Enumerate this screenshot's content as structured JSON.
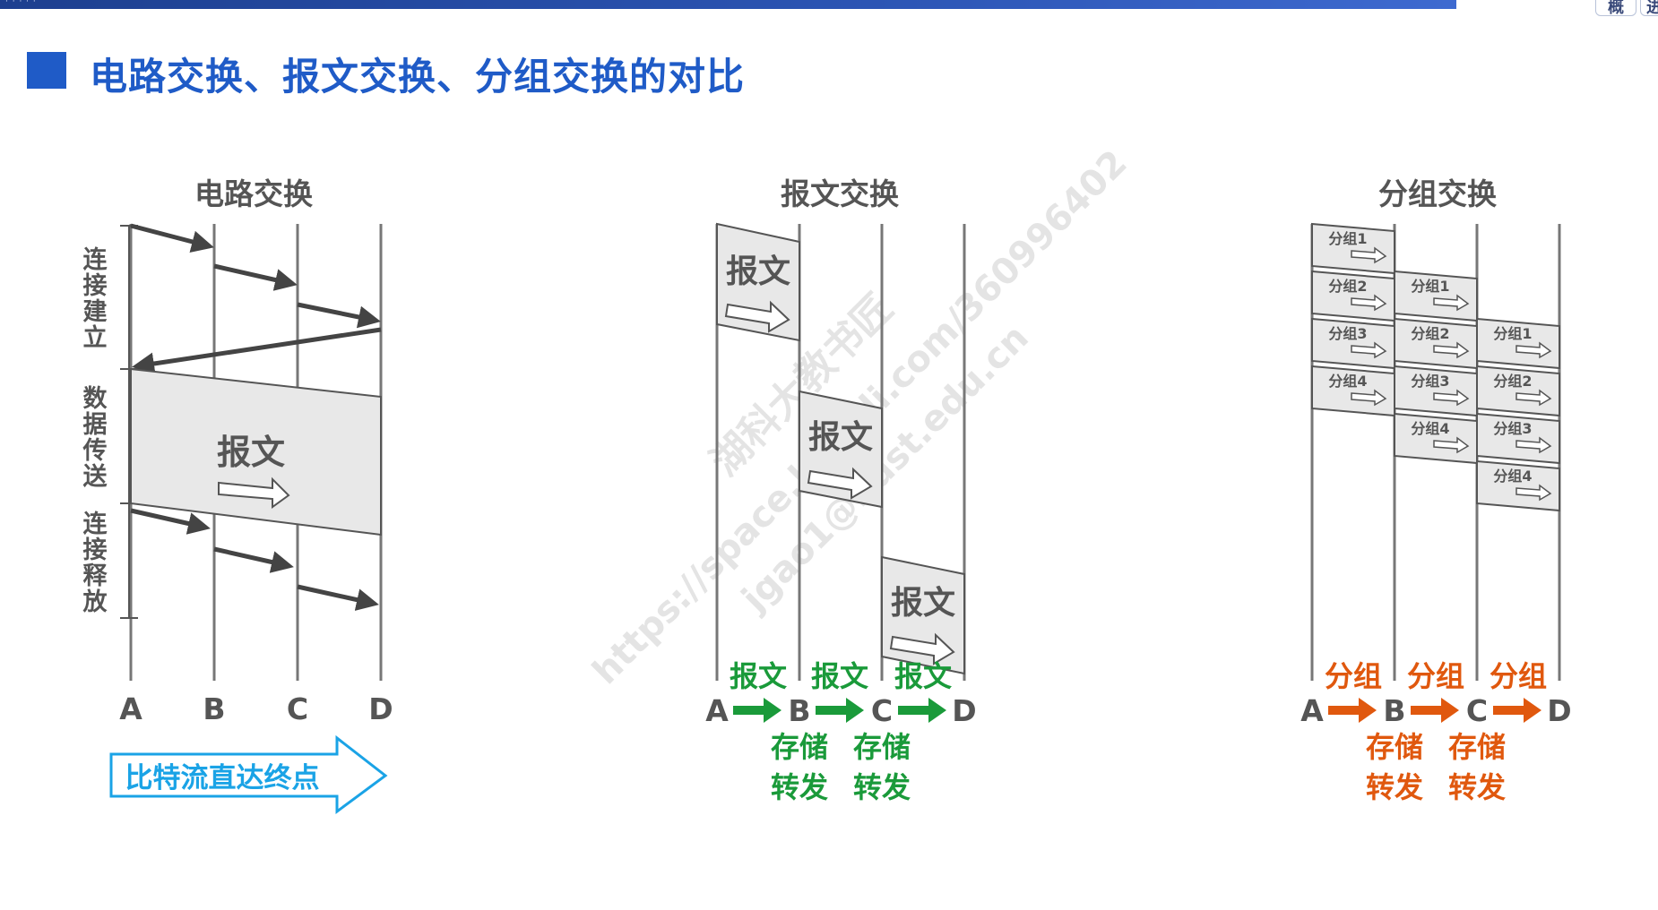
{
  "header": {
    "slide_title": "电路交换、报文交换、分组交换的对比",
    "corner_buttons": [
      "概",
      "进"
    ]
  },
  "watermark": {
    "line1": "湖科大教书匠",
    "line2": "https://space.bilibili.com/360996402",
    "line3": "jgao1@hust.edu.cn"
  },
  "nodes": [
    "A",
    "B",
    "C",
    "D"
  ],
  "circuit": {
    "title": "电路交换",
    "phase_setup": "连接建立",
    "phase_transfer": "数据传送",
    "phase_release": "连接释放",
    "message_label": "报文",
    "arrow_caption": "比特流直达终点"
  },
  "message": {
    "title": "报文交换",
    "block_label": "报文",
    "hop_label": "报文",
    "store_label": "存储",
    "forward_label": "转发"
  },
  "packet": {
    "title": "分组交换",
    "packets": [
      "分组1",
      "分组2",
      "分组3",
      "分组4"
    ],
    "hop_label": "分组",
    "store_label": "存储",
    "forward_label": "转发"
  },
  "colors": {
    "title_blue": "#1f5bc7",
    "green": "#1a9a3a",
    "orange": "#e0580e",
    "caption_blue": "#1aa3e6",
    "line_gray": "#6b6b6b"
  }
}
